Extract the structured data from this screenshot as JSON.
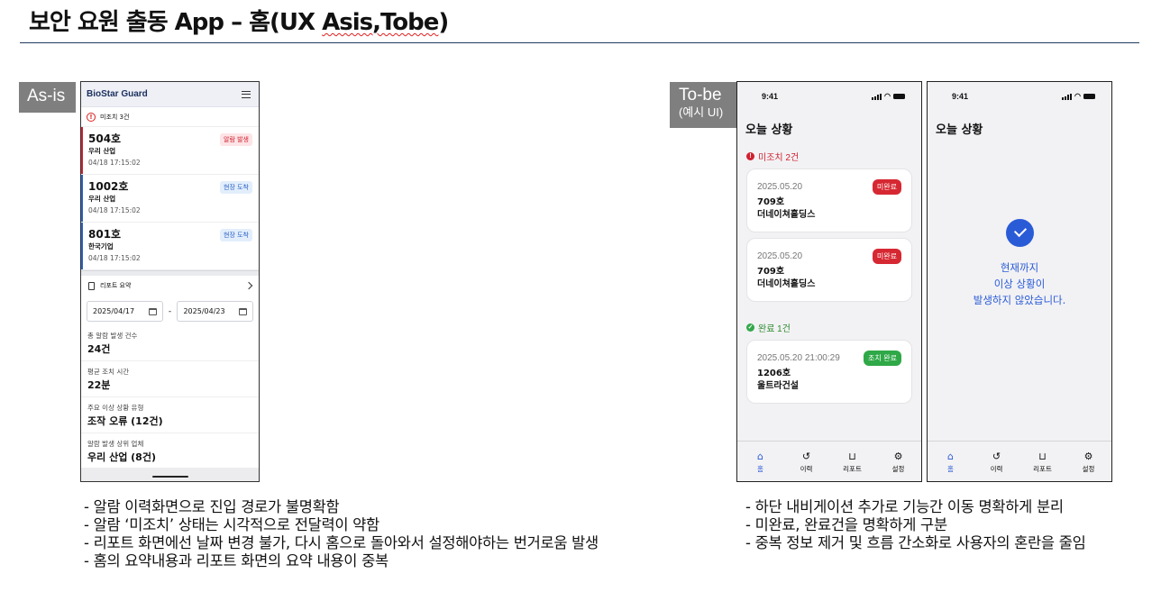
{
  "page": {
    "title_main": "보안 요원 출동 App – 홈(UX ",
    "title_squiggle": "Asis,Tobe",
    "title_end": ")"
  },
  "labels": {
    "asis": "As-is",
    "tobe_line1": "To-be",
    "tobe_line2": "(예시 UI)"
  },
  "asis": {
    "brand": "BioStar Guard",
    "pending": "미조치 3건",
    "cards": [
      {
        "room": "504호",
        "company": "우리 산업",
        "time": "04/18 17:15:02",
        "badge": "알람 발생",
        "bar_color": "#d0202e"
      },
      {
        "room": "1002호",
        "company": "우리 산업",
        "time": "04/18 17:15:02",
        "badge": "현장 도착",
        "bar_color": "#2a62c6"
      },
      {
        "room": "801호",
        "company": "한국기업",
        "time": "04/18 17:15:02",
        "badge": "현장 도착",
        "bar_color": "#2a62c6"
      }
    ],
    "report_label": "리포트 요약",
    "date_from": "2025/04/17",
    "date_sep": "-",
    "date_to": "2025/04/23",
    "stats": [
      {
        "key": "총 알람 발생 건수",
        "value": "24건"
      },
      {
        "key": "평균 조치 시간",
        "value": "22분"
      },
      {
        "key": "주요 이상 상황 유형",
        "value": "조작 오류 (12건)"
      },
      {
        "key": "알람 발생 상위 업체",
        "value": "우리 산업 (8건)"
      }
    ]
  },
  "tobe": {
    "time": "9:41",
    "title": "오늘 상황",
    "pending_section": "미조치 2건",
    "done_section": "완료 1건",
    "pending_cards": [
      {
        "date": "2025.05.20",
        "room": "709호",
        "company": "더네이쳐홀딩스",
        "badge": "미완료"
      },
      {
        "date": "2025.05.20",
        "room": "709호",
        "company": "더네이쳐홀딩스",
        "badge": "미완료"
      }
    ],
    "done_cards": [
      {
        "date": "2025.05.20  21:00:29",
        "room": "1206호",
        "company": "울트라건설",
        "badge": "조치 완료"
      }
    ],
    "empty_line1": "현재까지",
    "empty_line2": "이상 상황이",
    "empty_line3": "발생하지 않았습니다.",
    "tabs": [
      "홈",
      "이력",
      "리포트",
      "설정"
    ]
  },
  "notes_asis": [
    "- 알람 이력화면으로 진입 경로가 불명확함",
    "- 알람 ‘미조치’ 상태는 시각적으로 전달력이 약함",
    "- 리포트 화면에선 날짜 변경 불가, 다시 홈으로 돌아와서 설정해야하는 번거로움 발생",
    "- 홈의 요약내용과 리포트 화면의 요약 내용이 중복"
  ],
  "notes_tobe": [
    "- 하단 내비게이션 추가로 기능간 이동 명확하게 분리",
    "- 미완료, 완료건을 명확하게 구분",
    "- 중복 정보 제거 및 흐름 간소화로 사용자의 혼란을 줄임"
  ],
  "colors": {
    "accent_blue": "#2a5bd7",
    "alert_red": "#d62832",
    "done_green": "#2fa847",
    "label_gray": "#7f7f7f"
  },
  "icons": [
    "hamburger-icon",
    "warning-icon",
    "document-icon",
    "chevron-right-icon",
    "calendar-icon",
    "signal-icon",
    "wifi-icon",
    "battery-icon",
    "home-icon",
    "history-icon",
    "report-icon",
    "settings-icon",
    "check-icon"
  ]
}
